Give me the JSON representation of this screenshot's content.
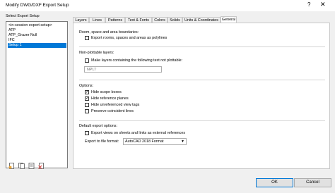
{
  "window": {
    "title": "Modify DWG/DXF Export Setup",
    "help_glyph": "?",
    "close_glyph": "✕"
  },
  "left": {
    "heading": "Select Export Setup",
    "items": [
      "<in-session export setup>",
      "ATP",
      "ATP_Grazer Null",
      "IFC",
      "Setup 1"
    ],
    "selected_index": 4
  },
  "tabs": [
    "Layers",
    "Lines",
    "Patterns",
    "Text & Fonts",
    "Colors",
    "Solids",
    "Units & Coordinates",
    "General"
  ],
  "active_tab": "General",
  "general": {
    "rooms_heading": "Room, space and area boundaries:",
    "export_rooms_label": "Export rooms, spaces and areas as polylines",
    "export_rooms_checked": false,
    "nonplot_heading": "Non-plottable layers:",
    "make_layers_label": "Make layers containing the following text not plottable:",
    "make_layers_checked": false,
    "nonplot_text": "NPLT",
    "options_heading": "Options:",
    "hide_scope_label": "Hide scope boxes",
    "hide_scope_checked": true,
    "hide_ref_label": "Hide reference planes",
    "hide_ref_checked": true,
    "hide_unref_label": "Hide unreferenced view tags",
    "hide_unref_checked": false,
    "preserve_label": "Preserve coincident lines",
    "preserve_checked": false,
    "default_heading": "Default export options:",
    "export_views_label": "Export views on sheets and links as external references",
    "export_views_checked": false,
    "format_label": "Export to file format:",
    "format_value": "AutoCAD 2018 Format"
  },
  "buttons": {
    "ok": "OK",
    "cancel": "Cancel"
  },
  "colors": {
    "accent": "#0078d7"
  }
}
